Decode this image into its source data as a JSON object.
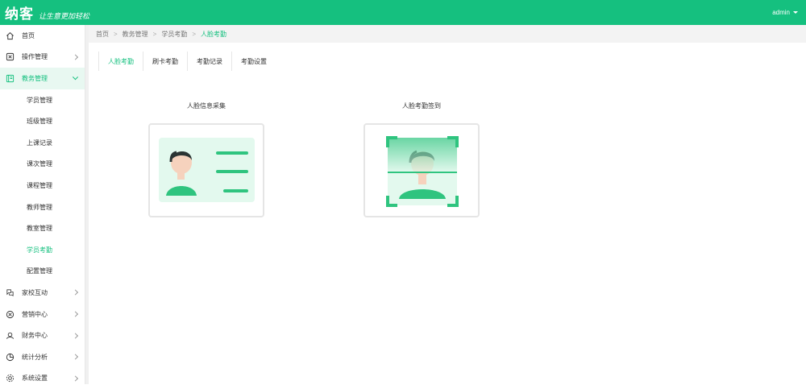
{
  "header": {
    "logo": "纳客",
    "slogan": "让生意更加轻松",
    "user": "admin"
  },
  "sidebar": {
    "items": [
      {
        "label": "首页",
        "icon": "home-icon"
      },
      {
        "label": "操作管理",
        "icon": "operation-icon"
      },
      {
        "label": "教务管理",
        "icon": "education-icon"
      }
    ],
    "sub_items": [
      {
        "label": "学员管理"
      },
      {
        "label": "班级管理"
      },
      {
        "label": "上课记录"
      },
      {
        "label": "课次管理"
      },
      {
        "label": "课程管理"
      },
      {
        "label": "教师管理"
      },
      {
        "label": "教室管理"
      },
      {
        "label": "学员考勤"
      },
      {
        "label": "配置管理"
      }
    ],
    "bottom_items": [
      {
        "label": "家校互动",
        "icon": "interaction-icon"
      },
      {
        "label": "营销中心",
        "icon": "marketing-icon"
      },
      {
        "label": "财务中心",
        "icon": "finance-icon"
      },
      {
        "label": "统计分析",
        "icon": "stats-icon"
      },
      {
        "label": "系统设置",
        "icon": "settings-icon"
      }
    ]
  },
  "breadcrumb": [
    "首页",
    "教务管理",
    "学员考勤",
    "人脸考勤"
  ],
  "tabs": [
    {
      "label": "人脸考勤",
      "active": true
    },
    {
      "label": "刷卡考勤"
    },
    {
      "label": "考勤记录"
    },
    {
      "label": "考勤设置"
    }
  ],
  "cards": [
    {
      "title": "人脸信息采集",
      "icon": "id-card-icon"
    },
    {
      "title": "人脸考勤签到",
      "icon": "face-scan-icon"
    }
  ],
  "colors": {
    "accent": "#15c07f",
    "light_accent": "#e8f8f1"
  }
}
